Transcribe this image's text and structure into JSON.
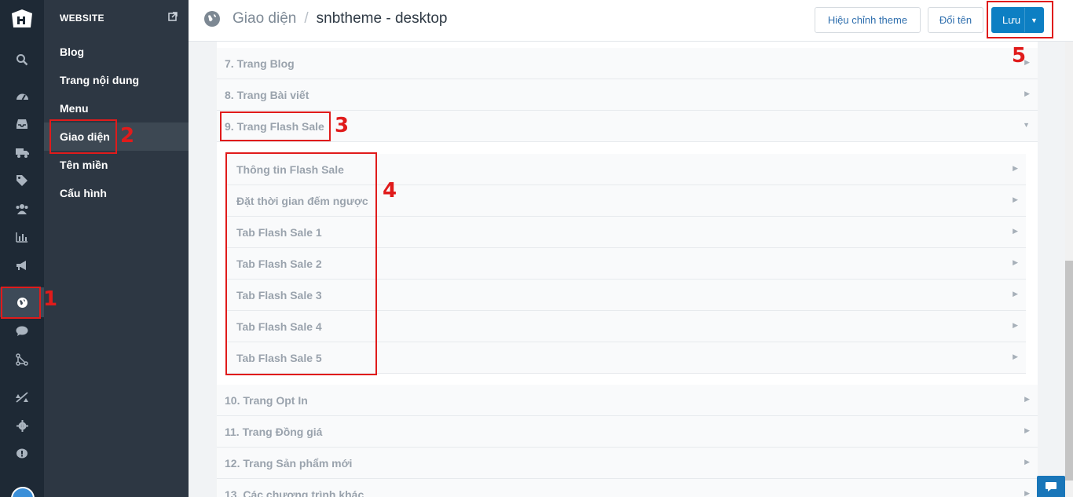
{
  "sidebar_rail": {
    "icons": [
      "logo-icon",
      "search-icon",
      "dashboard-icon",
      "inbox-icon",
      "truck-icon",
      "tag-icon",
      "users-icon",
      "chart-icon",
      "megaphone-icon",
      "globe-icon",
      "chat-icon",
      "share-icon",
      "scale-icon",
      "gear-icon",
      "feedback-icon"
    ],
    "active": "globe-icon"
  },
  "sub_sidebar": {
    "heading": "WEBSITE",
    "items": [
      {
        "label": "Blog"
      },
      {
        "label": "Trang nội dung"
      },
      {
        "label": "Menu"
      },
      {
        "label": "Giao diện"
      },
      {
        "label": "Tên miền"
      },
      {
        "label": "Cấu hình"
      }
    ],
    "active_index": 3
  },
  "header": {
    "breadcrumb_root": "Giao diện",
    "breadcrumb_sep": "/",
    "breadcrumb_current": "snbtheme - desktop",
    "btn_edit": "Hiệu chỉnh theme",
    "btn_rename": "Đổi tên",
    "btn_save": "Lưu"
  },
  "sections": [
    {
      "label": "7. Trang Blog"
    },
    {
      "label": "8. Trang Bài viết"
    },
    {
      "label": "9. Trang Flash Sale"
    },
    {
      "label": "10. Trang Opt In"
    },
    {
      "label": "11. Trang Đồng giá"
    },
    {
      "label": "12. Trang Sản phẩm mới"
    },
    {
      "label": "13. Các chương trình khác"
    }
  ],
  "flash_sale_subsections": [
    {
      "label": "Thông tin Flash Sale"
    },
    {
      "label": "Đặt thời gian đếm ngược"
    },
    {
      "label": "Tab Flash Sale 1"
    },
    {
      "label": "Tab Flash Sale 2"
    },
    {
      "label": "Tab Flash Sale 3"
    },
    {
      "label": "Tab Flash Sale 4"
    },
    {
      "label": "Tab Flash Sale 5"
    }
  ],
  "annotations": [
    "1",
    "2",
    "3",
    "4",
    "5"
  ],
  "colors": {
    "annotation": "#e01b1b",
    "primary": "#0d7fc3",
    "rail_bg": "#1e2935",
    "sub_bg": "#2d3743"
  }
}
